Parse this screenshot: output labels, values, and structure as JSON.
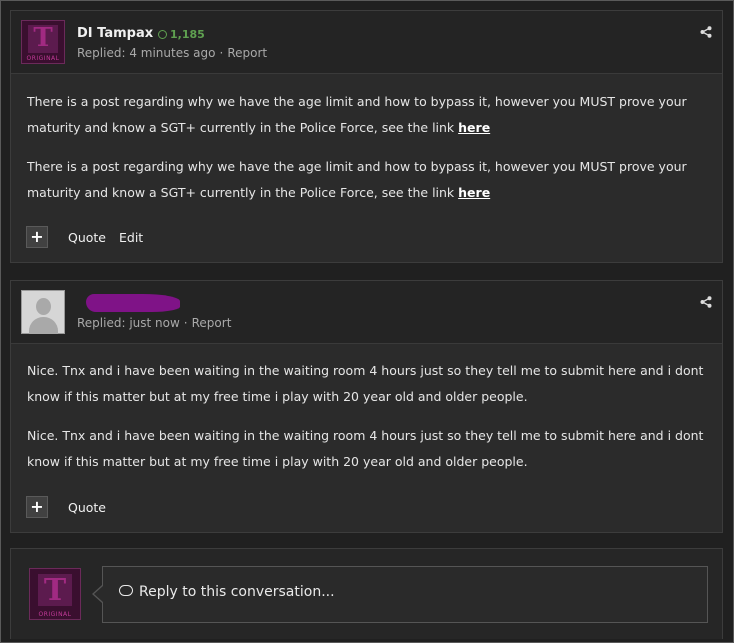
{
  "posts": [
    {
      "username": "DI Tampax",
      "reputation": "1,185",
      "meta": {
        "replied": "Replied: 4 minutes ago",
        "report": "Report"
      },
      "avatar": {
        "letter": "T",
        "tag": "ORIGINAL"
      },
      "paragraphs": [
        {
          "text": "There is a post regarding why we have the age limit and how to bypass it, however you MUST prove your maturity and know a SGT+ currently in the Police Force, see the link ",
          "link": "here"
        },
        {
          "text": "There is a post regarding why we have the age limit and how to bypass it, however you MUST prove your maturity and know a SGT+ currently in the Police Force, see the link ",
          "link": "here"
        }
      ],
      "actions": {
        "plus": "+",
        "quote": "Quote",
        "edit": "Edit"
      }
    },
    {
      "meta": {
        "replied": "Replied: just now",
        "report": "Report"
      },
      "paragraphs": [
        {
          "text": "Nice. Tnx and i have been waiting in the waiting room 4 hours just so they tell me to submit here and i dont know if this matter but at my free time i play with 20 year old and older people."
        },
        {
          "text": "Nice. Tnx and i have been waiting in the waiting room 4 hours just so they tell me to submit here and i dont know if this matter but at my free time i play with 20 year old and older people."
        }
      ],
      "actions": {
        "plus": "+",
        "quote": "Quote"
      }
    }
  ],
  "reply": {
    "placeholder": "Reply to this conversation...",
    "avatar": {
      "letter": "T",
      "tag": "ORIGINAL"
    }
  },
  "colors": {
    "reputation": "#5fa050",
    "redaction": "#7f1387"
  },
  "icons": [
    "share-icon",
    "plus-icon",
    "speech-bubble-icon",
    "reputation-icon"
  ]
}
